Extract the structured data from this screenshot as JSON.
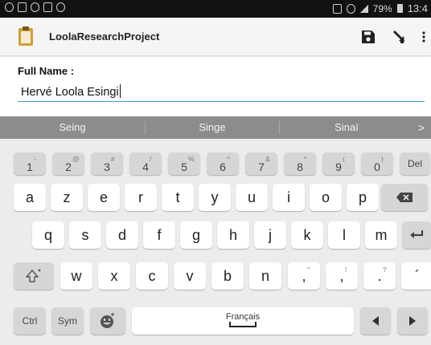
{
  "status_bar": {
    "battery": "79%",
    "time": "13:4"
  },
  "app_bar": {
    "title": "LoolaResearchProject",
    "icon": "clipboard-icon",
    "actions": [
      "save-icon",
      "share-icon",
      "more-vert-icon"
    ]
  },
  "form": {
    "full_name_label": "Full Name :",
    "full_name_value": "Hervé Loola Esingi"
  },
  "keyboard": {
    "suggestions": [
      "Seing",
      "Singe",
      "Sinaï"
    ],
    "suggestions_more": ">",
    "number_row": [
      {
        "main": "1",
        "sup": "-"
      },
      {
        "main": "2",
        "sup": "@"
      },
      {
        "main": "3",
        "sup": "#"
      },
      {
        "main": "4",
        "sup": "/"
      },
      {
        "main": "5",
        "sup": "%"
      },
      {
        "main": "6",
        "sup": "^"
      },
      {
        "main": "7",
        "sup": "&"
      },
      {
        "main": "8",
        "sup": "*"
      },
      {
        "main": "9",
        "sup": "("
      },
      {
        "main": "0",
        "sup": ")"
      }
    ],
    "del_label": "Del",
    "row1": [
      "a",
      "z",
      "e",
      "r",
      "t",
      "y",
      "u",
      "i",
      "o",
      "p"
    ],
    "row2": [
      "q",
      "s",
      "d",
      "f",
      "g",
      "h",
      "j",
      "k",
      "l",
      "m"
    ],
    "row3": [
      "w",
      "x",
      "c",
      "v",
      "b",
      "n"
    ],
    "row3_punct": [
      {
        "main": ",",
        "sup": "\""
      },
      {
        "main": ",",
        "sup": "!"
      },
      {
        "main": ".",
        "sup": "?"
      },
      {
        "main": "´",
        "sup": ""
      }
    ],
    "ctrl_label": "Ctrl",
    "sym_label": "Sym",
    "space_label": "Français"
  },
  "colors": {
    "accent": "#3c9fc9",
    "suggestion_bar": "#8c8c8c",
    "keyboard_bg": "#ececec",
    "fn_key": "#d6d6d6"
  }
}
